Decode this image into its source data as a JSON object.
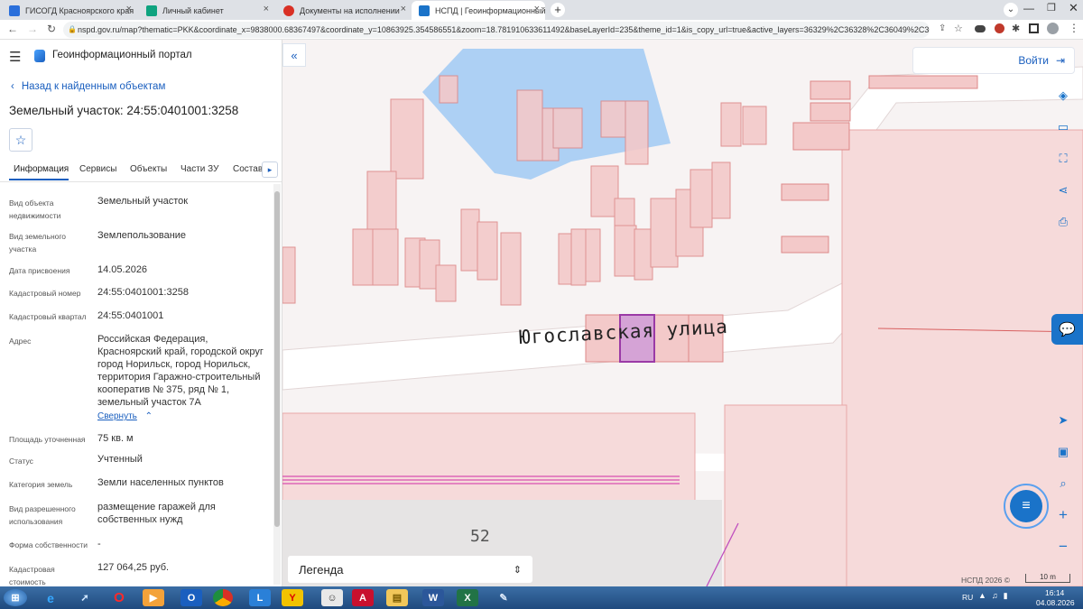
{
  "tabs": [
    {
      "label": "ГИСОГД Красноярского края",
      "color": "#2a6fdb"
    },
    {
      "label": "Личный кабинет",
      "color": "#0fa37f"
    },
    {
      "label": "Документы на исполнении",
      "color": "#d93025"
    },
    {
      "label": "НСПД | Геоинформационный п",
      "color": "#1a73c9"
    }
  ],
  "url": "nspd.gov.ru/map?thematic=PKK&coordinate_x=9838000.68367497&coordinate_y=10863925.354586551&zoom=18.781910633611492&baseLayerId=235&theme_id=1&is_copy_url=true&active_layers=36329%2C36328%2C36049%2C36048&...",
  "portal": {
    "title": "Геоинформационный портал"
  },
  "panel": {
    "back_label": "Назад к найденным объектам",
    "object_title": "Земельный участок: 24:55:0401001:3258",
    "tabs": [
      "Информация",
      "Сервисы",
      "Объекты",
      "Части ЗУ",
      "Состав"
    ],
    "collapse_label": "Свернуть",
    "fields": [
      {
        "label": "Вид объекта недвижимости",
        "value": "Земельный участок"
      },
      {
        "label": "Вид земельного участка",
        "value": "Землепользование"
      },
      {
        "label": "Дата присвоения",
        "value": "14.05.2026"
      },
      {
        "label": "Кадастровый номер",
        "value": "24:55:0401001:3258"
      },
      {
        "label": "Кадастровый квартал",
        "value": "24:55:0401001"
      },
      {
        "label": "Адрес",
        "value": "Российская Федерация, Красноярский край, городской округ город Норильск, город Норильск, территория Гаражно-строительный кооператив № 375, ряд № 1, земельный участок 7А"
      },
      {
        "label": "Площадь уточненная",
        "value": "75 кв. м"
      },
      {
        "label": "Статус",
        "value": "Учтенный"
      },
      {
        "label": "Категория земель",
        "value": "Земли населенных пунктов"
      },
      {
        "label": "Вид разрешенного использования",
        "value": "размещение гаражей для собственных нужд"
      },
      {
        "label": "Форма собственности",
        "value": "-"
      },
      {
        "label": "Кадастровая стоимость",
        "value": "127 064,25 руб."
      }
    ]
  },
  "map": {
    "login_label": "Войти",
    "street_label": "Югославская улица",
    "house_number": "52",
    "legend_label": "Легенда",
    "attribution": "НСПД 2026 ©",
    "scale_label": "10 m"
  },
  "taskbar": {
    "lang": "RU",
    "time": "16:14",
    "date": "04.08.2026"
  }
}
